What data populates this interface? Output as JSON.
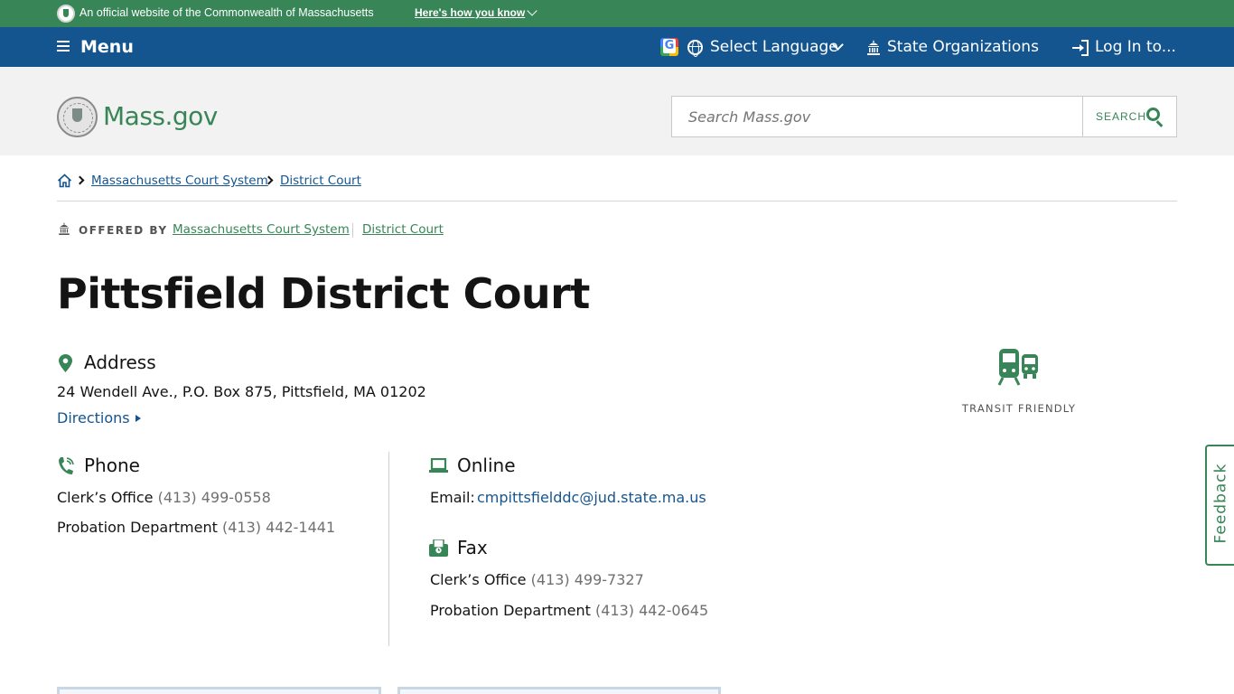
{
  "official_banner": {
    "text": "An official website of the Commonwealth of Massachusetts",
    "how_link": "Here's how you know"
  },
  "utility_nav": {
    "menu_label": "Menu",
    "language_label": "Select Language",
    "orgs_label": "State Organizations",
    "login_label": "Log In to..."
  },
  "header": {
    "logo_text": "Mass.gov",
    "search_placeholder": "Search Mass.gov",
    "search_button": "SEARCH"
  },
  "breadcrumb": {
    "items": [
      "Massachusetts Court System",
      "District Court"
    ]
  },
  "offered_by": {
    "label": "OFFERED BY",
    "links": [
      "Massachusetts Court System",
      "District Court"
    ]
  },
  "page": {
    "title": "Pittsfield District Court"
  },
  "address": {
    "heading": "Address",
    "text": "24 Wendell Ave., P.O. Box 875, Pittsfield, MA 01202",
    "directions": "Directions"
  },
  "phone": {
    "heading": "Phone",
    "entries": [
      {
        "label": "Clerk’s Office",
        "number": "(413) 499-0558"
      },
      {
        "label": "Probation Department",
        "number": "(413) 442-1441"
      }
    ]
  },
  "online": {
    "heading": "Online",
    "email_label": "Email:",
    "email": "cmpittsfielddc@jud.state.ma.us"
  },
  "fax": {
    "heading": "Fax",
    "entries": [
      {
        "label": "Clerk’s Office",
        "number": "(413) 499-7327"
      },
      {
        "label": "Probation Department",
        "number": "(413) 442-0645"
      }
    ]
  },
  "transit": {
    "label": "TRANSIT FRIENDLY"
  },
  "feedback": {
    "label": "Feedback"
  },
  "colors": {
    "green": "#388557",
    "blue": "#14558f"
  }
}
